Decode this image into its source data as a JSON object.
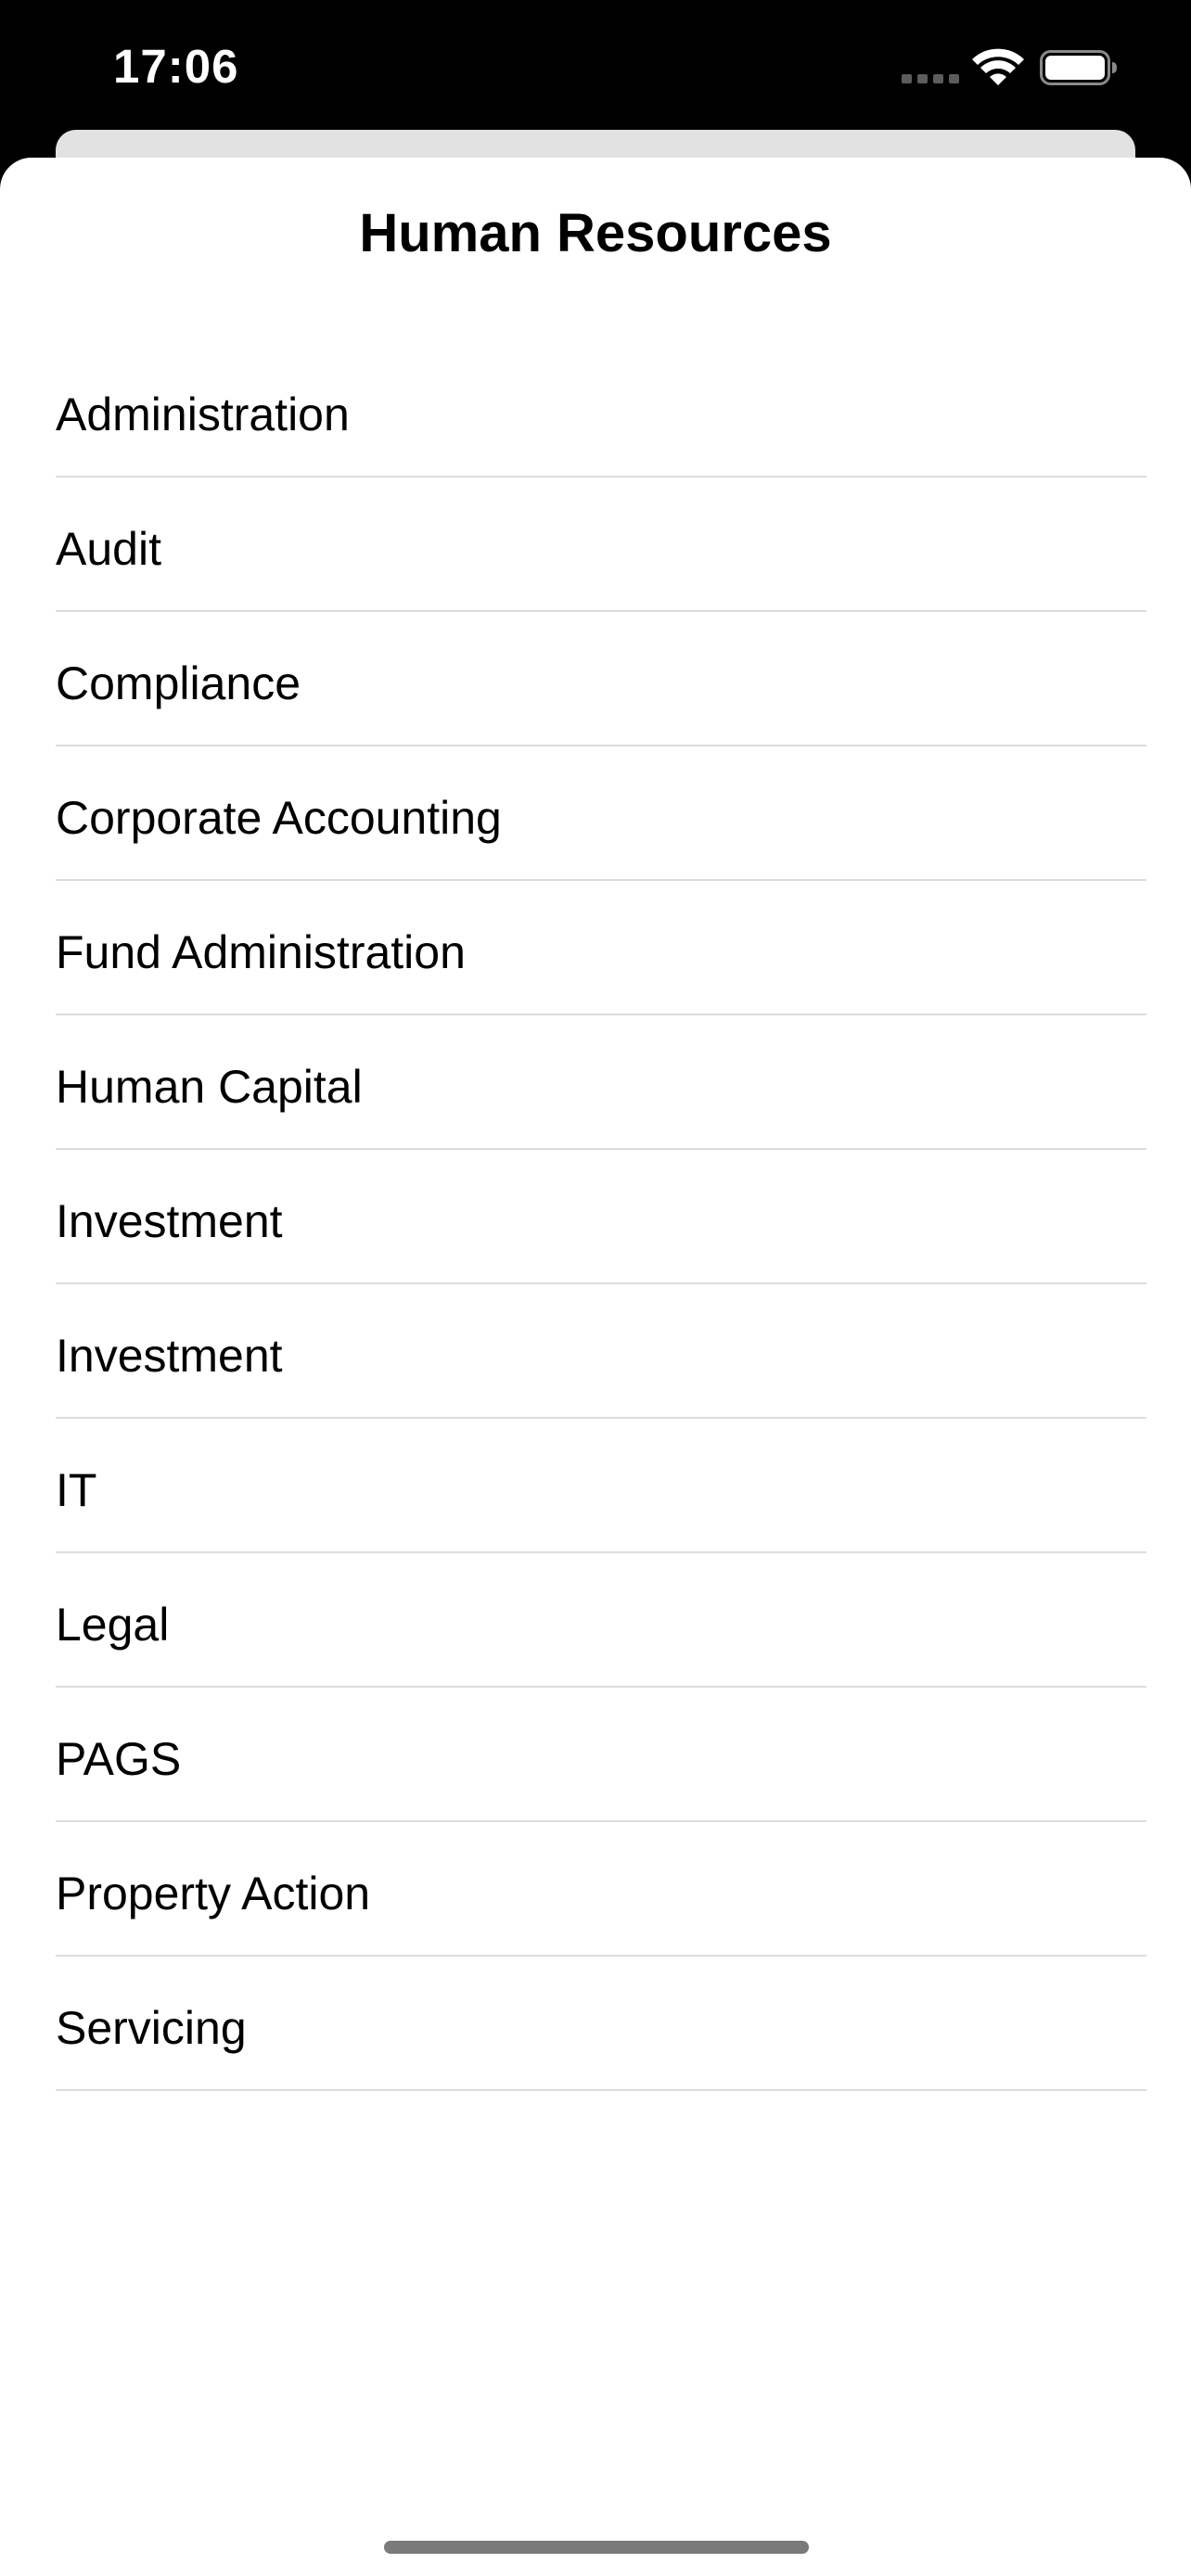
{
  "status_bar": {
    "time": "17:06"
  },
  "sheet": {
    "title": "Human Resources"
  },
  "departments": [
    {
      "label": "Administration"
    },
    {
      "label": "Audit"
    },
    {
      "label": "Compliance"
    },
    {
      "label": "Corporate Accounting"
    },
    {
      "label": "Fund Administration"
    },
    {
      "label": "Human Capital"
    },
    {
      "label": "Investment"
    },
    {
      "label": "Investment"
    },
    {
      "label": "IT"
    },
    {
      "label": "Legal"
    },
    {
      "label": "PAGS"
    },
    {
      "label": "Property Action"
    },
    {
      "label": "Servicing"
    }
  ],
  "colors": {
    "background": "#000000",
    "sheet": "#ffffff",
    "divider": "#dcdcdc",
    "text": "#000000"
  },
  "icons": [
    "cellular-signal-icon",
    "wifi-icon",
    "battery-icon"
  ]
}
